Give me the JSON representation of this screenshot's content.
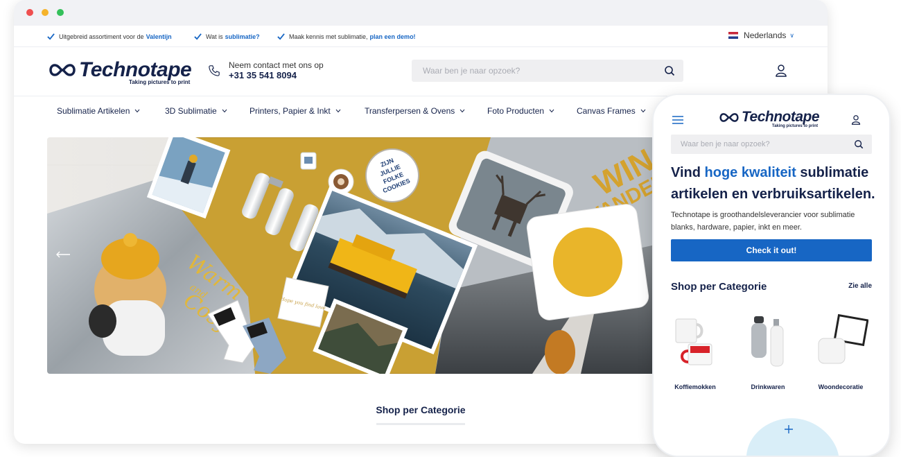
{
  "usp": [
    {
      "text": "Uitgebreid assortiment voor de",
      "link": "Valentijn"
    },
    {
      "text": "Wat is",
      "link": "sublimatie?"
    },
    {
      "text": "Maak kennis met sublimatie,",
      "link": "plan een demo!"
    }
  ],
  "language": "Nederlands",
  "logo": {
    "name": "Technotape",
    "tagline": "Taking pictures to print"
  },
  "contact": {
    "line1": "Neem contact met ons op",
    "phone": "+31 35 541 8094"
  },
  "search": {
    "placeholder": "Waar ben je naar opzoek?"
  },
  "nav": [
    {
      "label": "Sublimatie Artikelen"
    },
    {
      "label": "3D Sublimatie"
    },
    {
      "label": "Printers, Papier & Inkt"
    },
    {
      "label": "Transferpersen & Ovens"
    },
    {
      "label": "Foto Producten"
    },
    {
      "label": "Canvas Frames"
    }
  ],
  "hero": {
    "mug_text": [
      "ZIJN",
      "JULLIE",
      "FOLKE",
      "COOKIES"
    ],
    "script_text": [
      "Warm",
      "and",
      "Cosy"
    ],
    "blanket_text": [
      "WIN",
      "WANDER"
    ],
    "card_text": "Hope you find love"
  },
  "shop_title": "Shop per Categorie",
  "mobile": {
    "headline_pre": "Vind",
    "headline_highlight": "hoge kwaliteit",
    "headline_post": "sublimatie artikelen en verbruiksartikelen.",
    "subtext": "Technotape is groothandelsleverancier voor sublimatie blanks, hardware, papier, inkt en meer.",
    "button": "Check it out!",
    "shop_title": "Shop per Categorie",
    "see_all": "Zie alle",
    "categories": [
      {
        "label": "Koffiemokken"
      },
      {
        "label": "Drinkwaren"
      },
      {
        "label": "Woondecoratie"
      }
    ]
  },
  "colors": {
    "brand_blue": "#1766c4",
    "navy": "#15224a",
    "mustard": "#c9a033"
  }
}
